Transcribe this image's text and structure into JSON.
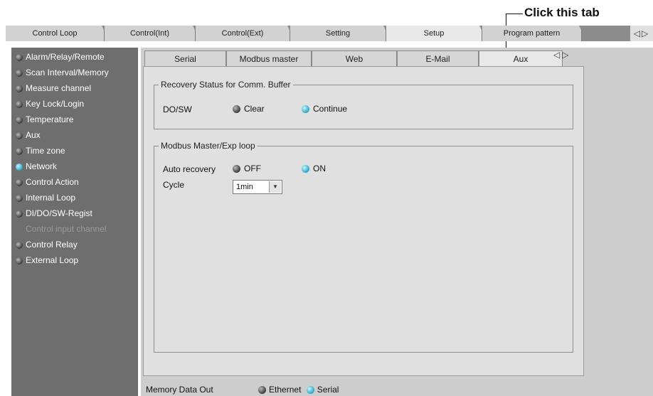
{
  "annotation": "Click this tab",
  "top_tabs": [
    "Control Loop",
    "Control(Int)",
    "Control(Ext)",
    "Setting",
    "Setup",
    "Program pattern"
  ],
  "arrows": "◁▷",
  "sidebar": [
    {
      "label": "Alarm/Relay/Remote",
      "state": "normal"
    },
    {
      "label": "Scan Interval/Memory",
      "state": "normal"
    },
    {
      "label": "Measure channel",
      "state": "normal"
    },
    {
      "label": "Key Lock/Login",
      "state": "normal"
    },
    {
      "label": "Temperature",
      "state": "normal"
    },
    {
      "label": "Aux",
      "state": "normal"
    },
    {
      "label": "Time zone",
      "state": "normal"
    },
    {
      "label": "Network",
      "state": "active"
    },
    {
      "label": "Control Action",
      "state": "normal"
    },
    {
      "label": "Internal Loop",
      "state": "normal"
    },
    {
      "label": "DI/DO/SW-Regist",
      "state": "normal"
    },
    {
      "label": "Control input channel",
      "state": "disabled"
    },
    {
      "label": "Control Relay",
      "state": "normal"
    },
    {
      "label": "External Loop",
      "state": "normal"
    }
  ],
  "sub_tabs": [
    "Serial",
    "Modbus master",
    "Web",
    "E-Mail",
    "Aux"
  ],
  "recovery_group": {
    "title": "Recovery Status for Comm. Buffer",
    "label": "DO/SW",
    "options": [
      "Clear",
      "Continue"
    ],
    "selected": "Continue"
  },
  "modbus_group": {
    "title": "Modbus Master/Exp loop",
    "auto_recovery_label": "Auto recovery",
    "options": [
      "OFF",
      "ON"
    ],
    "selected": "ON",
    "cycle_label": "Cycle",
    "cycle_value": "1min"
  },
  "memory_out": {
    "label": "Memory Data Out",
    "options": [
      "Ethernet",
      "Serial"
    ],
    "selected": "Serial"
  }
}
